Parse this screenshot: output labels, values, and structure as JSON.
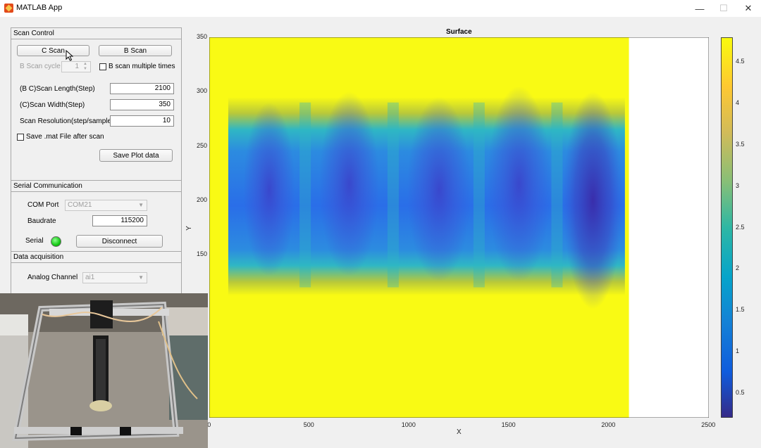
{
  "window": {
    "title": "MATLAB App",
    "minimize": "—",
    "maximize": "☐",
    "close": "✕"
  },
  "scan_control": {
    "title": "Scan Control",
    "c_scan_label": "C Scan",
    "b_scan_label": "B Scan",
    "b_scan_cycle_label": "B Scan cycle",
    "b_scan_cycle_value": "1",
    "b_scan_multiple_label": "B scan multiple times",
    "b_scan_multiple_checked": false,
    "scan_length_label": "(B C)Scan Length(Step)",
    "scan_length_value": "2100",
    "scan_width_label": "(C)Scan Width(Step)",
    "scan_width_value": "350",
    "scan_resolution_label": "Scan Resolution(step/sample)",
    "scan_resolution_value": "10",
    "save_mat_label": "Save .mat File after scan",
    "save_mat_checked": false,
    "save_plot_label": "Save Plot data"
  },
  "serial": {
    "title": "Serial Communication",
    "com_port_label": "COM Port",
    "com_port_value": "COM21",
    "baudrate_label": "Baudrate",
    "baudrate_value": "115200",
    "serial_label": "Serial",
    "status_color": "#14c814",
    "disconnect_label": "Disconnect"
  },
  "acquisition": {
    "title": "Data acquisition",
    "analog_channel_label": "Analog Channel",
    "analog_channel_value": "ai1"
  },
  "plot": {
    "title": "Surface",
    "xlabel": "X",
    "ylabel": "Y",
    "x_ticks": [
      "0",
      "500",
      "1000",
      "1500",
      "2000",
      "2500"
    ],
    "y_ticks": [
      "350",
      "300",
      "250",
      "200",
      "150"
    ],
    "colorbar_ticks": [
      "4.5",
      "4",
      "3.5",
      "3",
      "2.5",
      "2",
      "1.5",
      "1",
      "0.5"
    ],
    "colormap": "parula",
    "xlim": [
      0,
      2500
    ],
    "ylim": [
      0,
      350
    ],
    "data_extent_x": [
      0,
      2100
    ],
    "background_value": 4.8,
    "colorbar_range": [
      0.2,
      4.8
    ]
  },
  "camera_overlay": {
    "description_icon": "webcam-overlay"
  }
}
